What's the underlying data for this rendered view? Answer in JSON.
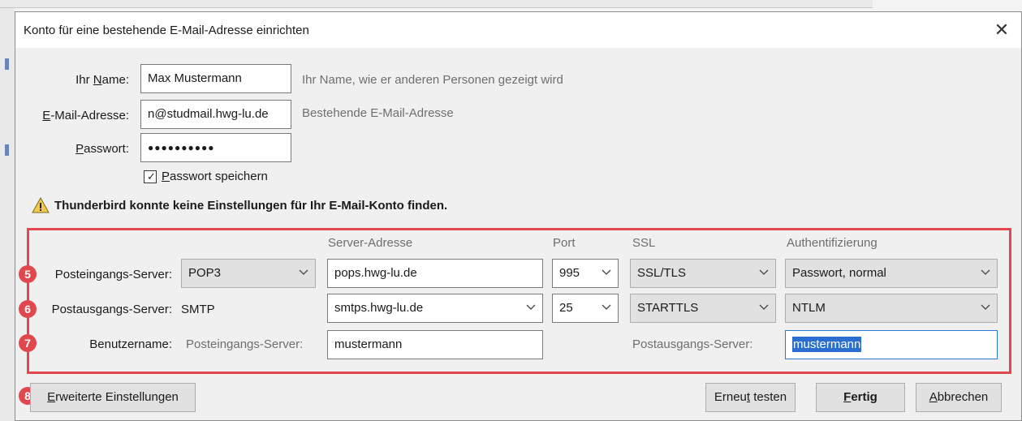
{
  "dialog": {
    "title": "Konto für eine bestehende E-Mail-Adresse einrichten"
  },
  "account": {
    "name_label_pre": "Ihr ",
    "name_label_u": "N",
    "name_label_post": "ame:",
    "name_value": "Max Mustermann",
    "name_hint": "Ihr Name, wie er anderen Personen gezeigt wird",
    "email_label_u": "E",
    "email_label_post": "-Mail-Adresse:",
    "email_value": "n@studmail.hwg-lu.de",
    "email_hint": "Bestehende E-Mail-Adresse",
    "password_label_u": "P",
    "password_label_post": "asswort:",
    "password_value": "●●●●●●●●●●",
    "remember_u": "P",
    "remember_post": "asswort speichern",
    "remember_checked": true
  },
  "warning": {
    "icon": "warning-icon",
    "text": "Thunderbird konnte keine Einstellungen für Ihr E-Mail-Konto finden."
  },
  "servers": {
    "headers": {
      "address": "Server-Adresse",
      "port": "Port",
      "ssl": "SSL",
      "auth": "Authentifizierung"
    },
    "incoming": {
      "badge": "5",
      "label": "Posteingangs-Server:",
      "protocol": "POP3",
      "address": "pops.hwg-lu.de",
      "port": "995",
      "ssl": "SSL/TLS",
      "auth": "Passwort, normal"
    },
    "outgoing": {
      "badge": "6",
      "label": "Postausgangs-Server:",
      "protocol": "SMTP",
      "address": "smtps.hwg-lu.de",
      "port": "25",
      "ssl": "STARTTLS",
      "auth": "NTLM"
    },
    "username": {
      "badge": "7",
      "label": "Benutzername:",
      "incoming_label": "Posteingangs-Server:",
      "incoming_value": "mustermann",
      "outgoing_label": "Postausgangs-Server:",
      "outgoing_value": "mustermann"
    }
  },
  "footer": {
    "advanced_badge": "8",
    "advanced_u": "E",
    "advanced_post": "rweiterte Einstellungen",
    "retest_pre": "Erneu",
    "retest_u": "t",
    "retest_post": " testen",
    "done_u": "F",
    "done_post": "ertig",
    "cancel_u": "A",
    "cancel_post": "bbrechen"
  },
  "colors": {
    "highlight_border": "#e0484e",
    "badge": "#e0484e",
    "selection": "#2a6fd0",
    "focus_border": "#2a7ad5"
  }
}
